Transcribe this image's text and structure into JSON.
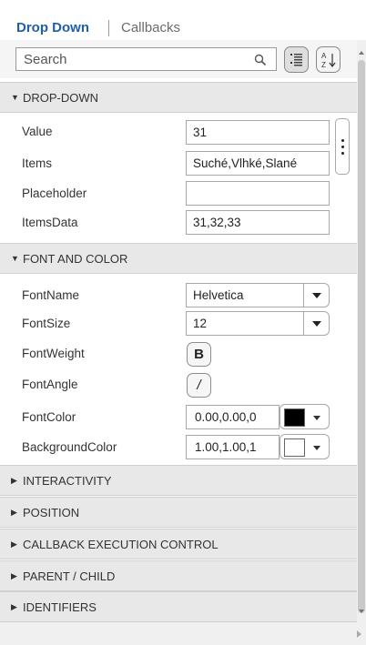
{
  "tabs": {
    "active": "Drop Down",
    "inactive": "Callbacks"
  },
  "search": {
    "placeholder": "Search"
  },
  "sections": {
    "dropdown": "DROP-DOWN",
    "font_color": "FONT AND COLOR",
    "interactivity": "INTERACTIVITY",
    "position": "POSITION",
    "callback": "CALLBACK EXECUTION CONTROL",
    "parent": "PARENT / CHILD",
    "identifiers": "IDENTIFIERS"
  },
  "dropdown_props": {
    "value": {
      "label": "Value",
      "value": "31"
    },
    "items": {
      "label": "Items",
      "value": "Suché,Vlhké,Slané"
    },
    "placeholder": {
      "label": "Placeholder",
      "value": ""
    },
    "itemsdata": {
      "label": "ItemsData",
      "value": "31,32,33"
    }
  },
  "font_props": {
    "fontname": {
      "label": "FontName",
      "value": "Helvetica"
    },
    "fontsize": {
      "label": "FontSize",
      "value": "12"
    },
    "fontweight": {
      "label": "FontWeight",
      "button": "B"
    },
    "fontangle": {
      "label": "FontAngle",
      "button": "/"
    },
    "fontcolor": {
      "label": "FontColor",
      "value": "0.00,0.00,0",
      "swatch": "#000000"
    },
    "bgcolor": {
      "label": "BackgroundColor",
      "value": "1.00,1.00,1",
      "swatch": "#ffffff"
    }
  },
  "icons": [
    "search-icon",
    "list-view-icon",
    "sort-az-icon",
    "more-options-icon",
    "chevron-down-icon",
    "chevron-right-icon"
  ]
}
